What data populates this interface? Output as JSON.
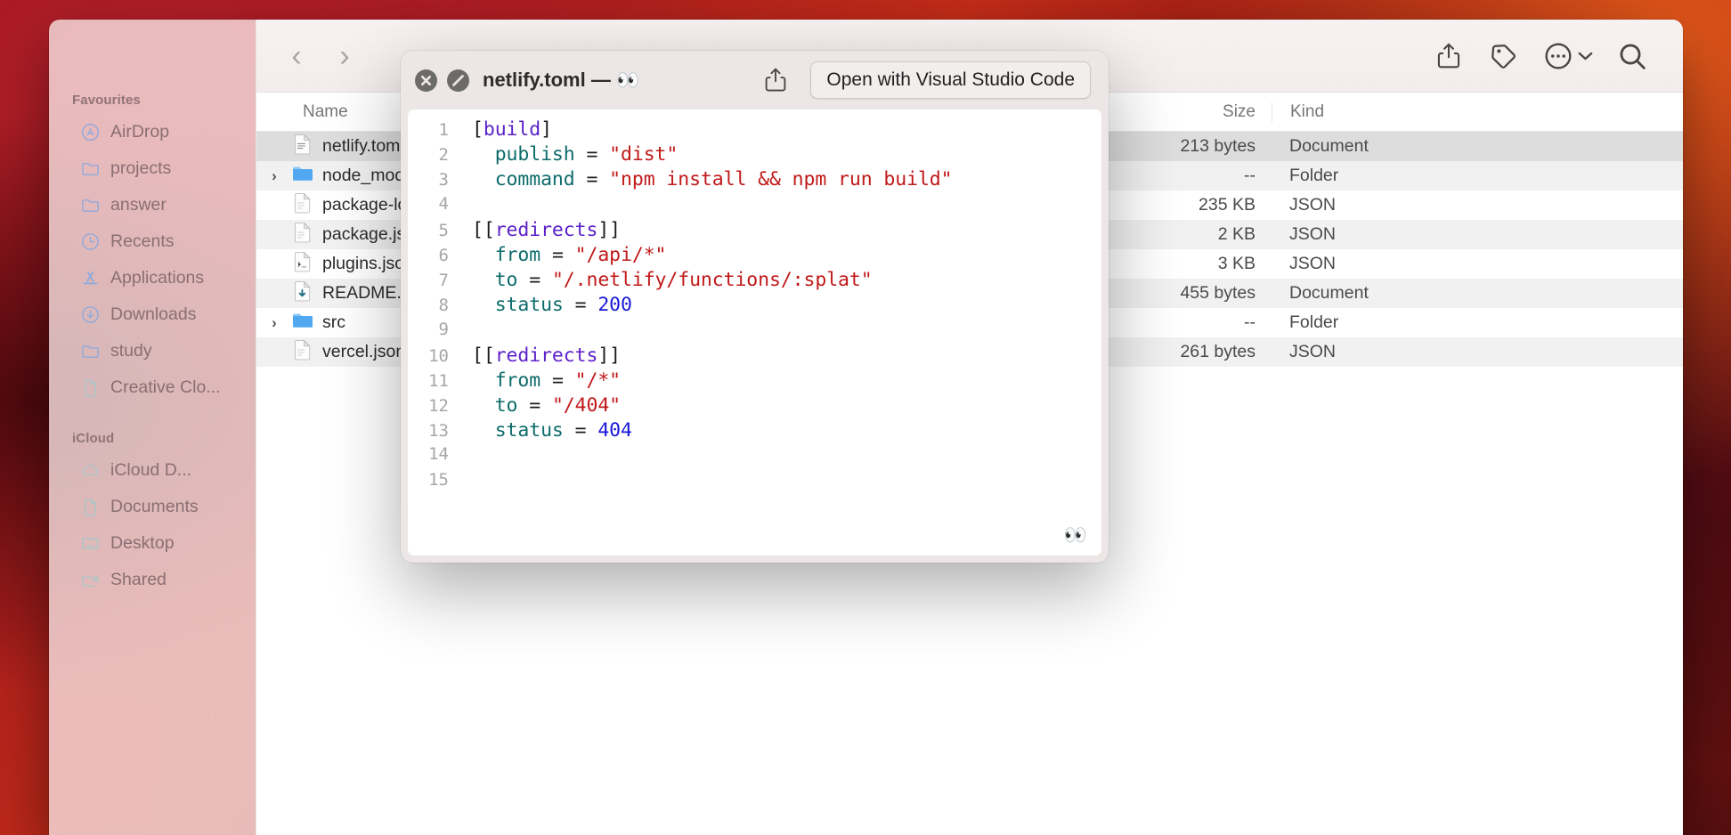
{
  "desktop": {
    "wallpaper_accent": "#b8202a"
  },
  "finder": {
    "toolbar": {
      "back_label": "‹",
      "forward_label": "›",
      "share_icon": "share-icon",
      "tag_icon": "tag-icon",
      "more_icon": "ellipsis-icon",
      "more_chevron": "⌄",
      "search_icon": "search-icon"
    },
    "sidebar": {
      "groups": [
        {
          "title": "Favourites",
          "items": [
            {
              "label": "AirDrop",
              "icon": "airdrop-icon"
            },
            {
              "label": "projects",
              "icon": "folder-icon"
            },
            {
              "label": "answer",
              "icon": "folder-icon"
            },
            {
              "label": "Recents",
              "icon": "clock-icon"
            },
            {
              "label": "Applications",
              "icon": "applications-icon"
            },
            {
              "label": "Downloads",
              "icon": "download-icon"
            },
            {
              "label": "study",
              "icon": "folder-icon"
            },
            {
              "label": "Creative Clo...",
              "icon": "document-icon"
            }
          ]
        },
        {
          "title": "iCloud",
          "items": [
            {
              "label": "iCloud D...",
              "icon": "cloud-icon"
            },
            {
              "label": "Documents",
              "icon": "document-icon"
            },
            {
              "label": "Desktop",
              "icon": "desktop-icon"
            },
            {
              "label": "Shared",
              "icon": "shared-folder-icon"
            }
          ]
        }
      ]
    },
    "columns": {
      "name": "Name",
      "size": "Size",
      "kind": "Kind"
    },
    "rows": [
      {
        "name": "netlify.toml",
        "size": "213 bytes",
        "kind": "Document",
        "icon": "toml-file-icon",
        "disclosure": "",
        "selected": true
      },
      {
        "name": "node_modules",
        "size": "--",
        "kind": "Folder",
        "icon": "folder-blue-icon",
        "disclosure": "›",
        "selected": false
      },
      {
        "name": "package-lock.json",
        "size": "235 KB",
        "kind": "JSON",
        "icon": "json-file-icon",
        "disclosure": "",
        "selected": false
      },
      {
        "name": "package.json",
        "size": "2 KB",
        "kind": "JSON",
        "icon": "json-file-icon",
        "disclosure": "",
        "selected": false
      },
      {
        "name": "plugins.json",
        "size": "3 KB",
        "kind": "JSON",
        "icon": "script-file-icon",
        "disclosure": "",
        "selected": false
      },
      {
        "name": "README.md",
        "size": "455 bytes",
        "kind": "Document",
        "icon": "markdown-file-icon",
        "disclosure": "",
        "selected": false
      },
      {
        "name": "src",
        "size": "--",
        "kind": "Folder",
        "icon": "folder-blue-icon",
        "disclosure": "›",
        "selected": false
      },
      {
        "name": "vercel.json",
        "size": "261 bytes",
        "kind": "JSON",
        "icon": "json-file-icon",
        "disclosure": "",
        "selected": false
      }
    ]
  },
  "quicklook": {
    "close_icon": "close-circle-icon",
    "block_icon": "no-entry-circle-icon",
    "title": "netlify.toml — ",
    "title_eyes": "👀",
    "share_icon": "share-icon",
    "open_with_label": "Open with Visual Studio Code",
    "corner_eyes": "👀",
    "file_name": "netlify.toml",
    "lines": [
      {
        "n": "1",
        "tokens": [
          {
            "t": "[",
            "c": "t-pun"
          },
          {
            "t": "build",
            "c": "t-tbl"
          },
          {
            "t": "]",
            "c": "t-pun"
          }
        ]
      },
      {
        "n": "2",
        "tokens": [
          {
            "t": "  ",
            "c": "t-pun"
          },
          {
            "t": "publish",
            "c": "t-key"
          },
          {
            "t": " = ",
            "c": "t-pun"
          },
          {
            "t": "\"dist\"",
            "c": "t-str"
          }
        ]
      },
      {
        "n": "3",
        "tokens": [
          {
            "t": "  ",
            "c": "t-pun"
          },
          {
            "t": "command",
            "c": "t-key"
          },
          {
            "t": " = ",
            "c": "t-pun"
          },
          {
            "t": "\"npm install && npm run build\"",
            "c": "t-str"
          }
        ]
      },
      {
        "n": "4",
        "tokens": []
      },
      {
        "n": "5",
        "tokens": [
          {
            "t": "[[",
            "c": "t-pun"
          },
          {
            "t": "redirects",
            "c": "t-tbl"
          },
          {
            "t": "]]",
            "c": "t-pun"
          }
        ]
      },
      {
        "n": "6",
        "tokens": [
          {
            "t": "  ",
            "c": "t-pun"
          },
          {
            "t": "from",
            "c": "t-key"
          },
          {
            "t": " = ",
            "c": "t-pun"
          },
          {
            "t": "\"/api/*\"",
            "c": "t-str"
          }
        ]
      },
      {
        "n": "7",
        "tokens": [
          {
            "t": "  ",
            "c": "t-pun"
          },
          {
            "t": "to",
            "c": "t-key"
          },
          {
            "t": " = ",
            "c": "t-pun"
          },
          {
            "t": "\"/.netlify/functions/:splat\"",
            "c": "t-str"
          }
        ]
      },
      {
        "n": "8",
        "tokens": [
          {
            "t": "  ",
            "c": "t-pun"
          },
          {
            "t": "status",
            "c": "t-key"
          },
          {
            "t": " = ",
            "c": "t-pun"
          },
          {
            "t": "200",
            "c": "t-num"
          }
        ]
      },
      {
        "n": "9",
        "tokens": []
      },
      {
        "n": "10",
        "tokens": [
          {
            "t": "[[",
            "c": "t-pun"
          },
          {
            "t": "redirects",
            "c": "t-tbl"
          },
          {
            "t": "]]",
            "c": "t-pun"
          }
        ]
      },
      {
        "n": "11",
        "tokens": [
          {
            "t": "  ",
            "c": "t-pun"
          },
          {
            "t": "from",
            "c": "t-key"
          },
          {
            "t": " = ",
            "c": "t-pun"
          },
          {
            "t": "\"/*\"",
            "c": "t-str"
          }
        ]
      },
      {
        "n": "12",
        "tokens": [
          {
            "t": "  ",
            "c": "t-pun"
          },
          {
            "t": "to",
            "c": "t-key"
          },
          {
            "t": " = ",
            "c": "t-pun"
          },
          {
            "t": "\"/404\"",
            "c": "t-str"
          }
        ]
      },
      {
        "n": "13",
        "tokens": [
          {
            "t": "  ",
            "c": "t-pun"
          },
          {
            "t": "status",
            "c": "t-key"
          },
          {
            "t": " = ",
            "c": "t-pun"
          },
          {
            "t": "404",
            "c": "t-num"
          }
        ]
      },
      {
        "n": "14",
        "tokens": []
      },
      {
        "n": "15",
        "tokens": []
      }
    ]
  }
}
